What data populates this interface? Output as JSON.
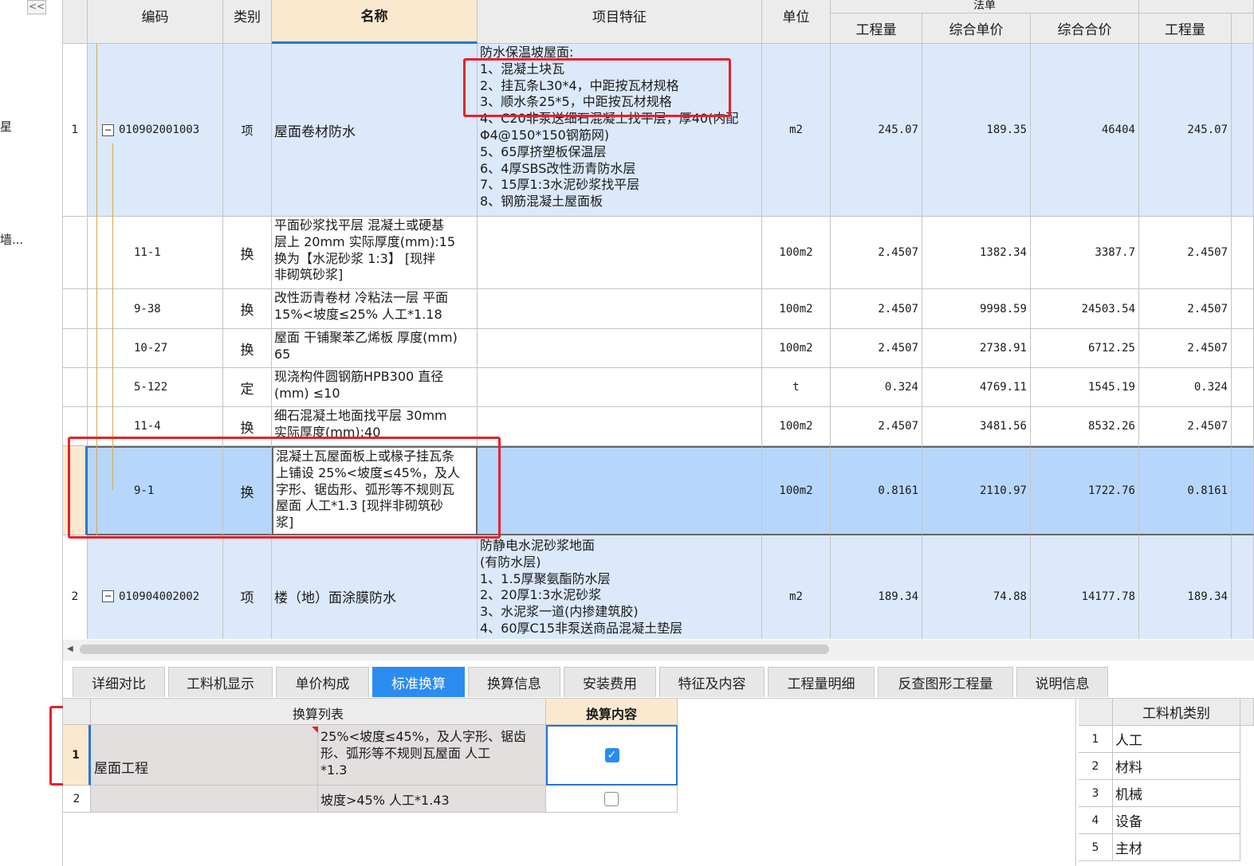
{
  "left_panel": {
    "collapse_label": "<<",
    "item_a": "星",
    "item_b": "墙..."
  },
  "grid": {
    "headers": {
      "code": "编码",
      "category": "类别",
      "name": "名称",
      "feature": "项目特征",
      "unit": "单位",
      "group": "法单",
      "qty": "工程量",
      "unit_price": "综合单价",
      "total_price": "综合合价",
      "qty2": "工程量"
    },
    "rows": [
      {
        "idx": "1",
        "code": "010902001003",
        "cat": "项",
        "name": "屋面卷材防水",
        "feature": "防水保温坡屋面:\n1、混凝土块瓦\n2、挂瓦条L30*4，中距按瓦材规格\n3、顺水条25*5，中距按瓦材规格\n4、C20非泵送细石混凝土找平层，厚40(内配\nΦ4@150*150钢筋网)\n5、65厚挤塑板保温层\n6、4厚SBS改性沥青防水层\n7、15厚1:3水泥砂浆找平层\n8、钢筋混凝土屋面板",
        "unit": "m2",
        "qty": "245.07",
        "price": "189.35",
        "total": "46404",
        "qty2": "245.07"
      },
      {
        "idx": "",
        "code": "11-1",
        "cat": "换",
        "name": "平面砂浆找平层 混凝土或硬基\n层上 20mm  实际厚度(mm):15\n换为【水泥砂浆 1:3】 [现拌\n非砌筑砂浆]",
        "feature": "",
        "unit": "100m2",
        "qty": "2.4507",
        "price": "1382.34",
        "total": "3387.7",
        "qty2": "2.4507"
      },
      {
        "idx": "",
        "code": "9-38",
        "cat": "换",
        "name": "改性沥青卷材 冷粘法一层 平面\n 15%<坡度≤25% 人工*1.18",
        "feature": "",
        "unit": "100m2",
        "qty": "2.4507",
        "price": "9998.59",
        "total": "24503.54",
        "qty2": "2.4507"
      },
      {
        "idx": "",
        "code": "10-27",
        "cat": "换",
        "name": "屋面 干铺聚苯乙烯板 厚度(mm)\n65",
        "feature": "",
        "unit": "100m2",
        "qty": "2.4507",
        "price": "2738.91",
        "total": "6712.25",
        "qty2": "2.4507"
      },
      {
        "idx": "",
        "code": "5-122",
        "cat": "定",
        "name": "现浇构件圆钢筋HPB300 直径\n(mm) ≤10",
        "feature": "",
        "unit": "t",
        "qty": "0.324",
        "price": "4769.11",
        "total": "1545.19",
        "qty2": "0.324"
      },
      {
        "idx": "",
        "code": "11-4",
        "cat": "换",
        "name": "细石混凝土地面找平层 30mm\n实际厚度(mm):40",
        "feature": "",
        "unit": "100m2",
        "qty": "2.4507",
        "price": "3481.56",
        "total": "8532.26",
        "qty2": "2.4507"
      },
      {
        "idx": "",
        "code": "9-1",
        "cat": "换",
        "name": "混凝土瓦屋面板上或椽子挂瓦条\n上铺设  25%<坡度≤45%，及人\n字形、锯齿形、弧形等不规则瓦\n屋面 人工*1.3  [现拌非砌筑砂\n浆]",
        "feature": "",
        "unit": "100m2",
        "qty": "0.8161",
        "price": "2110.97",
        "total": "1722.76",
        "qty2": "0.8161"
      },
      {
        "idx": "2",
        "code": "010904002002",
        "cat": "项",
        "name": "楼（地）面涂膜防水",
        "feature": "防静电水泥砂浆地面\n(有防水层)\n1、1.5厚聚氨酯防水层\n2、20厚1:3水泥砂浆\n3、水泥浆一道(内掺建筑胶)\n4、60厚C15非泵送商品混凝土垫层",
        "unit": "m2",
        "qty": "189.34",
        "price": "74.88",
        "total": "14177.78",
        "qty2": "189.34"
      }
    ]
  },
  "tabs": [
    "详细对比",
    "工料机显示",
    "单价构成",
    "标准换算",
    "换算信息",
    "安装费用",
    "特征及内容",
    "工程量明细",
    "反查图形工程量",
    "说明信息"
  ],
  "active_tab": "标准换算",
  "conversion": {
    "header_list": "换算列表",
    "header_content": "换算内容",
    "rows": [
      {
        "idx": "1",
        "group": "屋面工程",
        "text": "25%<坡度≤45%，及人字形、锯齿\n形、弧形等不规则瓦屋面 人工\n*1.3",
        "checked": true
      },
      {
        "idx": "2",
        "group": "",
        "text": "坡度>45% 人工*1.43",
        "checked": false
      }
    ]
  },
  "material_types": {
    "header": "工料机类别",
    "rows": [
      {
        "idx": "1",
        "label": "人工"
      },
      {
        "idx": "2",
        "label": "材料"
      },
      {
        "idx": "3",
        "label": "机械"
      },
      {
        "idx": "4",
        "label": "设备"
      },
      {
        "idx": "5",
        "label": "主材"
      }
    ]
  },
  "colors": {
    "row_blue": "#dbe9fb",
    "row_selected": "#b7d6fb",
    "accent": "#2b8cf0",
    "annotation": "#e8202a"
  }
}
